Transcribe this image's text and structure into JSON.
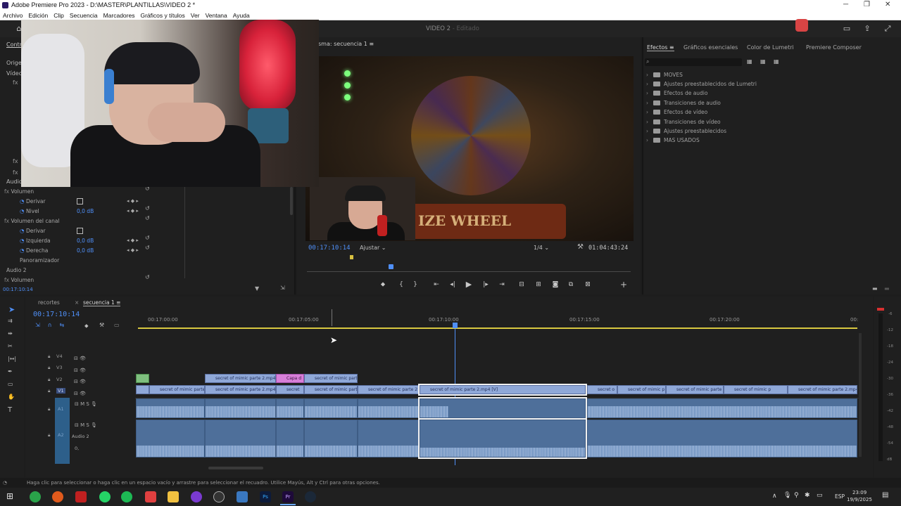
{
  "titlebar": {
    "title": "Adobe Premiere Pro 2023 - D:\\MASTER\\PLANTILLAS\\VIDEO 2 *"
  },
  "menu": [
    "Archivo",
    "Edición",
    "Clip",
    "Secuencia",
    "Marcadores",
    "Gráficos y títulos",
    "Ver",
    "Ventana",
    "Ayuda"
  ],
  "header": {
    "project": "VIDEO 2",
    "separator": " - ",
    "state": "Editado"
  },
  "left_panel": {
    "tab": "Contro",
    "sections": [
      "Origen",
      "Vídeo",
      "Audio",
      "Audio 2"
    ],
    "rows": [
      {
        "label": "Volumen",
        "indent": 1
      },
      {
        "label": "Derivar",
        "indent": 2,
        "checkbox": true
      },
      {
        "label": "Nivel",
        "indent": 2,
        "value": "0,0 dB"
      },
      {
        "label": "Volumen del canal",
        "indent": 1
      },
      {
        "label": "Derivar",
        "indent": 2,
        "checkbox": true
      },
      {
        "label": "Izquierda",
        "indent": 2,
        "value": "0,0 dB"
      },
      {
        "label": "Derecha",
        "indent": 2,
        "value": "0,0 dB"
      },
      {
        "label": "Panoramizador",
        "indent": 1
      }
    ],
    "audio2_row": "Volumen",
    "timecode": "00:17:10:14"
  },
  "program": {
    "label": "sma: secuencia 1",
    "timecode": "00:17:10:14",
    "fit": "Ajustar",
    "resolution": "1/4",
    "duration": "01:04:43:24",
    "sign_text": "IZE WHEEL"
  },
  "effects": {
    "tabs": [
      "Efectos",
      "Gráficos esenciales",
      "Color de Lumetri",
      "Premiere Composer"
    ],
    "items": [
      "MOVES",
      "Ajustes preestablecidos de Lumetri",
      "Efectos de audio",
      "Transiciones de audio",
      "Efectos de vídeo",
      "Transiciones de vídeo",
      "Ajustes preestablecidos",
      "MAS USADOS"
    ]
  },
  "timeline": {
    "tabs": [
      "recortes",
      "secuencia 1"
    ],
    "timecode": "00:17:10:14",
    "ruler": [
      "00:17:00:00",
      "00:17:05:00",
      "00:17:10:00",
      "00:17:15:00",
      "00:17:20:00",
      "00:"
    ],
    "tracks": [
      "V4",
      "V3",
      "V2",
      "V1",
      "A1",
      "A2"
    ],
    "audio2_label": "Audio 2",
    "audio2_value": "0,",
    "v2_clips": [
      "",
      "secret of mimic parte 2.mp4",
      "Capa d",
      "secret of mimic part"
    ],
    "v1_clips": [
      "secret of mimic parte",
      "secret of mimic parte 2.mp4 [",
      "secret",
      "secret of mimic part",
      "secret of mimic parte 2",
      "secret of mimic parte 2.mp4 [V]",
      "secret o",
      "secret of mimic p",
      "secret of mimic parte 2",
      "secret of mimic p",
      "secret of mimic parte 2.mp4"
    ],
    "meter_labels": [
      "-6",
      "-12",
      "-18",
      "-24",
      "-30",
      "-36",
      "-42",
      "-48",
      "-54",
      "dB"
    ]
  },
  "status": {
    "text": "Haga clic para seleccionar o haga clic en un espacio vacío y arrastre para seleccionar el recuadro. Utilice Mayús, Alt y Ctrl para otras opciones."
  },
  "taskbar": {
    "lang": "ESP",
    "time": "23:09",
    "date": "19/9/2025"
  }
}
